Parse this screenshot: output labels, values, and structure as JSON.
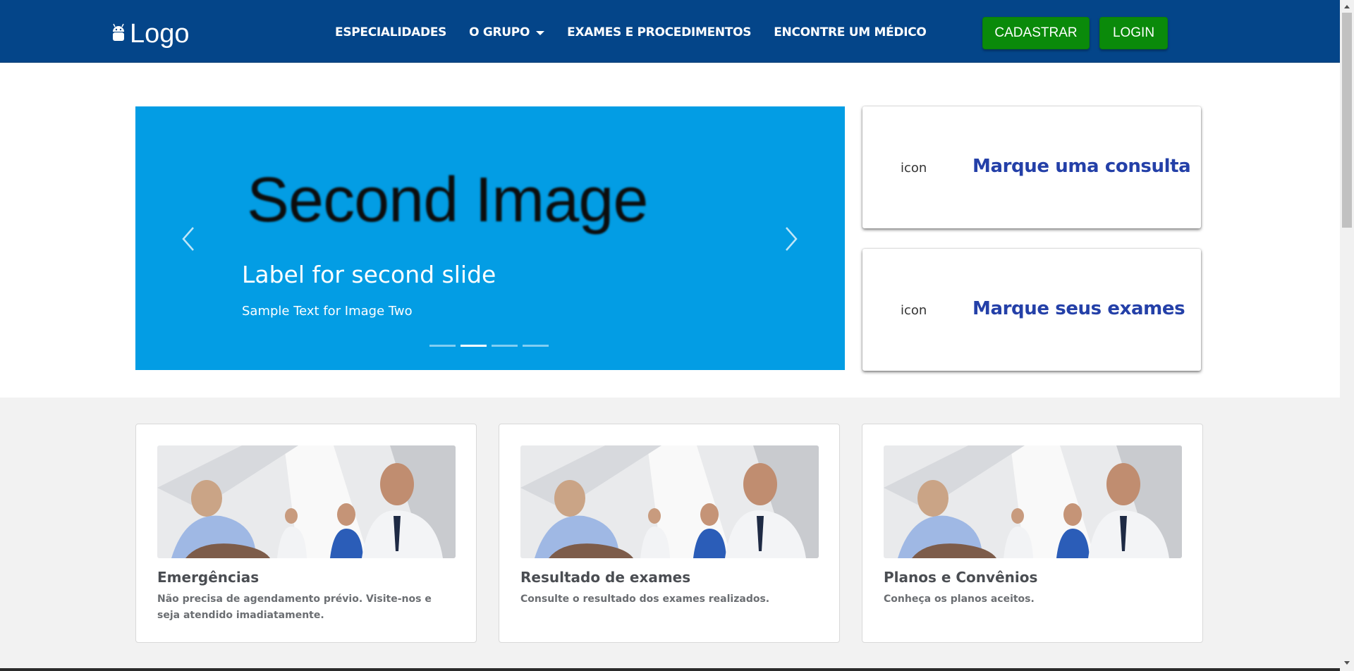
{
  "header": {
    "logo_text": "Logo",
    "nav": [
      {
        "label": "ESPECIALIDADES"
      },
      {
        "label": "O GRUPO",
        "has_dropdown": true
      },
      {
        "label": "EXAMES E PROCEDIMENTOS"
      },
      {
        "label": "ENCONTRE UM MÉDICO"
      }
    ],
    "cadastrar_label": "CADASTRAR",
    "login_label": "LOGIN",
    "colors": {
      "navbar": "#044589",
      "button": "#0a8a0a"
    }
  },
  "carousel": {
    "image_text": "Second Image",
    "label": "Label for second slide",
    "caption": "Sample Text for Image Two",
    "slides_count": 4,
    "active_index": 1,
    "background": "#039de4",
    "prev_icon": "chevron-left-icon",
    "next_icon": "chevron-right-icon"
  },
  "actions": [
    {
      "icon_text": "icon",
      "title": "Marque uma consulta"
    },
    {
      "icon_text": "icon",
      "title": "Marque seus exames"
    }
  ],
  "services": [
    {
      "title": "Emergências",
      "description": "Não precisa de agendamento prévio. Visite-nos e seja atendido imadiatamente."
    },
    {
      "title": "Resultado de exames",
      "description": "Consulte o resultado dos exames realizados."
    },
    {
      "title": "Planos e Convênios",
      "description": "Conheça os planos aceitos."
    }
  ]
}
